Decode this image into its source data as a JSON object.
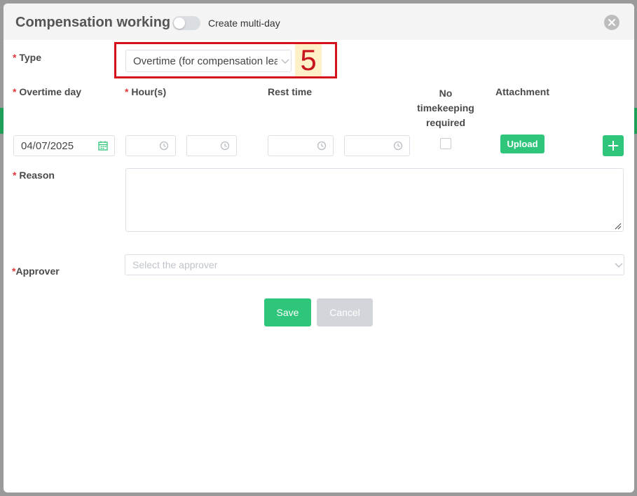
{
  "dialog": {
    "title": "Compensation working",
    "multiday_label": "Create multi-day",
    "multiday_enabled": false
  },
  "type_field": {
    "label": "Type",
    "value": "Overtime (for compensation leave)"
  },
  "annotation": {
    "number": "5",
    "color": "#d3121c"
  },
  "columns": {
    "overtime_day": "Overtime day",
    "hours": "Hour(s)",
    "rest_time": "Rest time",
    "no_timekeeping": "No timekeeping required",
    "attachment": "Attachment"
  },
  "row": {
    "date": "04/07/2025",
    "hour_from": "",
    "hour_to": "",
    "rest_from": "",
    "rest_to": "",
    "no_timekeeping_checked": false,
    "upload_label": "Upload"
  },
  "reason": {
    "label": "Reason",
    "value": ""
  },
  "approver": {
    "label": "Approver",
    "placeholder": "Select the approver"
  },
  "buttons": {
    "save": "Save",
    "cancel": "Cancel"
  },
  "colors": {
    "accent": "#2fc57a",
    "required": "#e0383e"
  }
}
